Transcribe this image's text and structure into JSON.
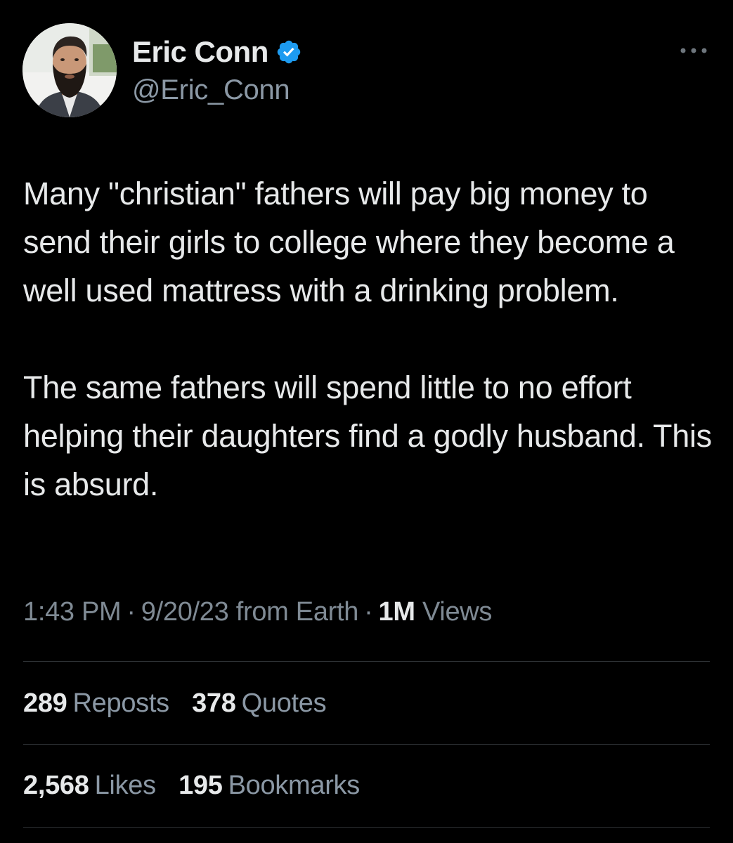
{
  "author": {
    "display_name": "Eric Conn",
    "handle": "@Eric_Conn",
    "verified_color": "#1d9bf0"
  },
  "tweet": {
    "paragraphs": [
      "Many \"christian\" fathers will pay big money to send their girls to college where they become a well used mattress with a drinking problem.",
      "The same fathers will spend little to no effort helping their daughters find a godly husband. This is absurd."
    ],
    "time": "1:43 PM",
    "date": "9/20/23",
    "source": "from Earth",
    "separator": "·",
    "views_count": "1M",
    "views_label": "Views"
  },
  "stats": {
    "reposts": {
      "count": "289",
      "label": "Reposts"
    },
    "quotes": {
      "count": "378",
      "label": "Quotes"
    },
    "likes": {
      "count": "2,568",
      "label": "Likes"
    },
    "bookmarks": {
      "count": "195",
      "label": "Bookmarks"
    }
  },
  "icons": {
    "verified": "verified-badge-icon",
    "more": "more-options-icon"
  },
  "colors": {
    "background": "#000000",
    "text_primary": "#e7e9ea",
    "text_secondary": "#8b98a5",
    "divider": "#2f3336",
    "accent": "#1d9bf0"
  }
}
